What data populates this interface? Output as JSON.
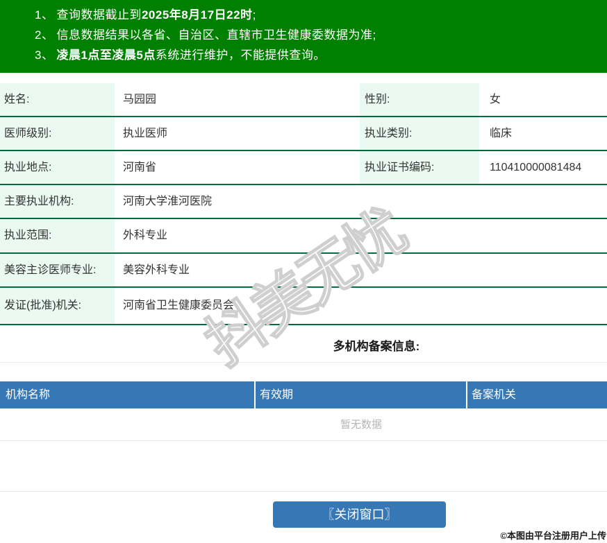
{
  "banner": {
    "lines": [
      {
        "num": "1、",
        "pre": "查询数据截止到",
        "bold": "2025年8月17日22时",
        "post": ";"
      },
      {
        "num": "2、",
        "pre": "信息数据结果以各省、自治区、直辖市卫生健康委数据为准;",
        "bold": "",
        "post": ""
      },
      {
        "num": "3、",
        "pre": "",
        "bold": "凌晨1点至凌晨5点",
        "post": "系统进行维护，不能提供查询。"
      }
    ]
  },
  "profile": {
    "rows": [
      {
        "label1": "姓名:",
        "value1": "马园园",
        "label2": "性别:",
        "value2": "女"
      },
      {
        "label1": "医师级别:",
        "value1": "执业医师",
        "label2": "执业类别:",
        "value2": "临床"
      },
      {
        "label1": "执业地点:",
        "value1": "河南省",
        "label2": "执业证书编码:",
        "value2": "110410000081484"
      },
      {
        "label1": "主要执业机构:",
        "value1": "河南大学淮河医院"
      },
      {
        "label1": "执业范围:",
        "value1": "外科专业"
      },
      {
        "label1": "美容主诊医师专业:",
        "value1": "美容外科专业"
      },
      {
        "label1": "发证(批准)机关:",
        "value1": "河南省卫生健康委员会"
      }
    ]
  },
  "filing": {
    "title": "多机构备案信息:",
    "columns": [
      "机构名称",
      "有效期",
      "备案机关"
    ],
    "empty_text": "暂无数据"
  },
  "footer": {
    "close_button": "〖关闭窗口〗",
    "copyright": "©本图由平台注册用户上传"
  },
  "watermark": "抖美无忧",
  "colors": {
    "banner_green": "#008000",
    "row_border_green": "#006b3c",
    "label_bg_mint": "#eaf9f1",
    "header_blue": "#3578b5",
    "button_blue": "#3578b5",
    "empty_text_gray": "#b5b5b5"
  }
}
